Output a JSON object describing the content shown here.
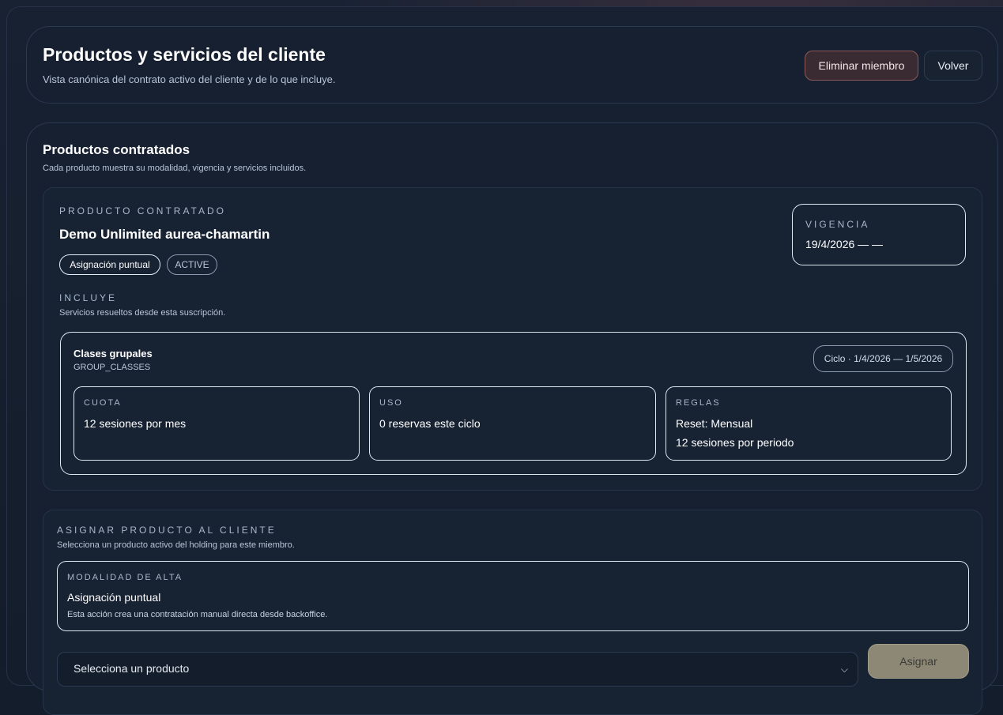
{
  "header": {
    "title": "Productos y servicios del cliente",
    "subtitle": "Vista canónica del contrato activo del cliente y de lo que incluye.",
    "remove_member_label": "Eliminar miembro",
    "back_label": "Volver"
  },
  "products_section": {
    "title": "Productos contratados",
    "subtitle": "Cada producto muestra su modalidad, vigencia y servicios incluidos.",
    "product": {
      "eyebrow": "PRODUCTO CONTRATADO",
      "name": "Demo Unlimited aurea-chamartin",
      "modality_tag": "Asignación puntual",
      "status_tag": "ACTIVE",
      "validity_label": "VIGENCIA",
      "validity_value": "19/4/2026 — —",
      "includes_label": "INCLUYE",
      "includes_subtitle": "Servicios resueltos desde esta suscripción.",
      "service": {
        "name": "Clases grupales",
        "code": "GROUP_CLASSES",
        "cycle": "Ciclo · 1/4/2026 — 1/5/2026",
        "quota_label": "CUOTA",
        "quota_value": "12 sesiones por mes",
        "usage_label": "USO",
        "usage_value": "0 reservas este ciclo",
        "rules_label": "REGLAS",
        "rules_reset": "Reset: Mensual",
        "rules_sessions": "12 sesiones por periodo"
      }
    }
  },
  "assign_section": {
    "title": "ASIGNAR PRODUCTO AL CLIENTE",
    "subtitle": "Selecciona un producto activo del holding para este miembro.",
    "modality_label": "MODALIDAD DE ALTA",
    "modality_value": "Asignación puntual",
    "modality_note": "Esta acción crea una contratación manual directa desde backoffice.",
    "select_placeholder": "Selecciona un producto",
    "assign_label": "Asignar"
  }
}
